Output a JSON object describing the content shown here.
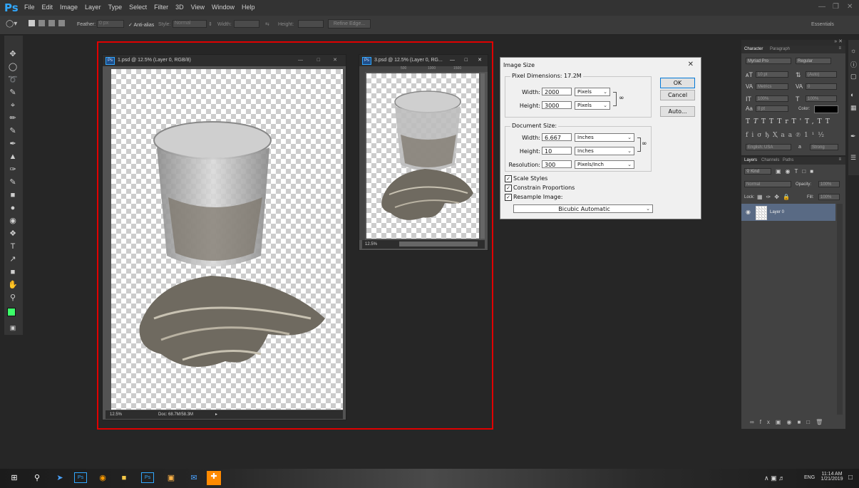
{
  "app": {
    "logo": "Ps",
    "menu": [
      "File",
      "Edit",
      "Image",
      "Layer",
      "Type",
      "Select",
      "Filter",
      "3D",
      "View",
      "Window",
      "Help"
    ],
    "workspace": "Essentials"
  },
  "options_bar": {
    "feather_label": "Feather:",
    "feather_value": "0 px",
    "antialias_label": "Anti-alias",
    "style_label": "Style:",
    "style_value": "Normal",
    "width_label": "Width:",
    "height_label": "Height:",
    "refine_edge": "Refine Edge..."
  },
  "documents": [
    {
      "title": "1.psd @ 12.5% (Layer 0, RGB/8)",
      "zoom": "12.5%",
      "doc_info": "Doc: 68.7M/58.3M"
    },
    {
      "title": "3.psd @ 12.5% (Layer 0, RG...",
      "zoom": "12.5%",
      "ruler": [
        "500",
        "1000",
        "1500"
      ]
    }
  ],
  "image_size_dialog": {
    "title": "Image Size",
    "pixel_dimensions_label": "Pixel Dimensions:",
    "pixel_dimensions_value": "17.2M",
    "width_label": "Width:",
    "width_value": "2000",
    "width_unit": "Pixels",
    "height_label": "Height:",
    "height_value": "3000",
    "height_unit": "Pixels",
    "document_size_label": "Document Size:",
    "doc_width_label": "Width:",
    "doc_width_value": "6.667",
    "doc_width_unit": "Inches",
    "doc_height_label": "Height:",
    "doc_height_value": "10",
    "doc_height_unit": "Inches",
    "resolution_label": "Resolution:",
    "resolution_value": "300",
    "resolution_unit": "Pixels/Inch",
    "scale_styles": "Scale Styles",
    "constrain_proportions": "Constrain Proportions",
    "resample_image": "Resample Image:",
    "resample_method": "Bicubic Automatic",
    "ok": "OK",
    "cancel": "Cancel",
    "auto": "Auto..."
  },
  "character_panel": {
    "tabs": [
      "Character",
      "Paragraph"
    ],
    "font_family": "Myriad Pro",
    "font_style": "Regular",
    "size": "10 pt",
    "leading": "(Auto)",
    "kerning": "Metrics",
    "tracking": "0",
    "vscale": "100%",
    "hscale": "100%",
    "baseline": "0 pt",
    "color_label": "Color:",
    "language": "English: USA",
    "aa_label": "a",
    "antialias": "Strong"
  },
  "layers_panel": {
    "tabs": [
      "Layers",
      "Channels",
      "Paths"
    ],
    "kind": "Kind",
    "blend_mode": "Normal",
    "opacity_label": "Opacity:",
    "opacity_value": "100%",
    "lock_label": "Lock:",
    "fill_label": "Fill:",
    "fill_value": "100%",
    "layer_name": "Layer 0"
  },
  "taskbar": {
    "language": "ENG",
    "time": "11:14 AM",
    "date": "1/21/2019"
  }
}
